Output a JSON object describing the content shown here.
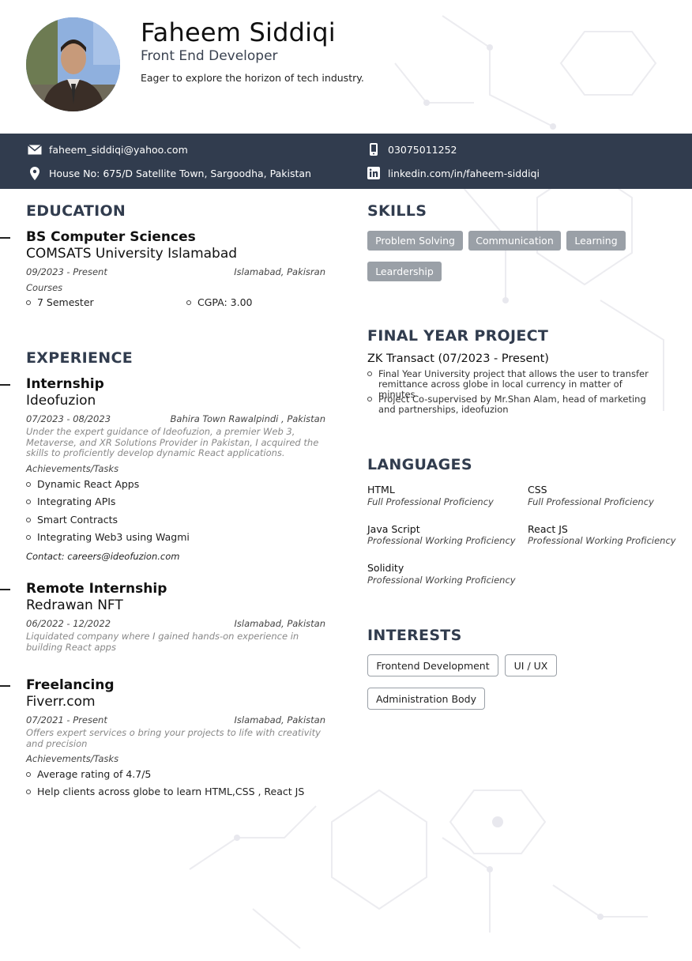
{
  "header": {
    "name": "Faheem Siddiqi",
    "role": "Front End Developer",
    "tagline": "Eager to explore the horizon of tech industry."
  },
  "contact": {
    "email": "faheem_siddiqi@yahoo.com",
    "phone": "03075011252",
    "address": "House No: 675/D Satellite Town, Sargoodha, Pakistan",
    "linkedin": "linkedin.com/in/faheem-siddiqi"
  },
  "education": {
    "title": "EDUCATION",
    "degree": "BS Computer Sciences",
    "school": "COMSATS University Islamabad",
    "dates": "09/2023 - Present",
    "location": "Islamabad, Pakisran",
    "courses_label": "Courses",
    "courses": [
      "7 Semester",
      "CGPA: 3.00"
    ]
  },
  "experience": {
    "title": "EXPERIENCE",
    "items": [
      {
        "title": "Internship",
        "org": "Ideofuzion",
        "dates": "07/2023 - 08/2023",
        "location": "Bahira Town Rawalpindi , Pakistan",
        "desc": "Under the expert guidance of Ideofuzion, a premier Web 3, Metaverse, and XR Solutions Provider in Pakistan, I acquired the skills to proficiently develop dynamic React applications.",
        "achievements_label": "Achievements/Tasks",
        "achievements": [
          "Dynamic React Apps",
          "Integrating APIs",
          "Smart Contracts",
          "Integrating Web3 using Wagmi"
        ],
        "contact": "Contact: careers@ideofuzion.com"
      },
      {
        "title": "Remote Internship",
        "org": "Redrawan NFT",
        "dates": "06/2022 - 12/2022",
        "location": "Islamabad, Pakistan",
        "desc": "Liquidated company where I gained hands-on experience in building React apps"
      },
      {
        "title": "Freelancing",
        "org": "Fiverr.com",
        "dates": "07/2021 - Present",
        "location": "Islamabad, Pakistan",
        "desc": "Offers expert services o bring your projects to life with creativity and precision",
        "achievements_label": "Achievements/Tasks",
        "achievements": [
          "Average rating of 4.7/5",
          "Help clients across globe to learn HTML,CSS , React JS"
        ]
      }
    ]
  },
  "skills": {
    "title": "SKILLS",
    "items": [
      "Problem Solving",
      "Communication",
      "Learning",
      "Leardership"
    ]
  },
  "project": {
    "title": "FINAL YEAR PROJECT",
    "name": "ZK Transact (07/2023 - Present)",
    "bullets": [
      "Final Year University project that allows the user to transfer remittance across globe in local currency in matter of minutes",
      "Project Co-supervised by Mr.Shan Alam, head of marketing and partnerships, ideofuzion"
    ]
  },
  "languages": {
    "title": "LANGUAGES",
    "items": [
      {
        "name": "HTML",
        "level": "Full Professional Proficiency"
      },
      {
        "name": "CSS",
        "level": "Full Professional Proficiency"
      },
      {
        "name": "Java Script",
        "level": "Professional Working Proficiency"
      },
      {
        "name": "React JS",
        "level": "Professional Working Proficiency"
      },
      {
        "name": "Solidity",
        "level": "Professional Working Proficiency"
      }
    ]
  },
  "interests": {
    "title": "INTERESTS",
    "items": [
      "Frontend Development",
      "UI / UX",
      "Administration Body"
    ]
  }
}
